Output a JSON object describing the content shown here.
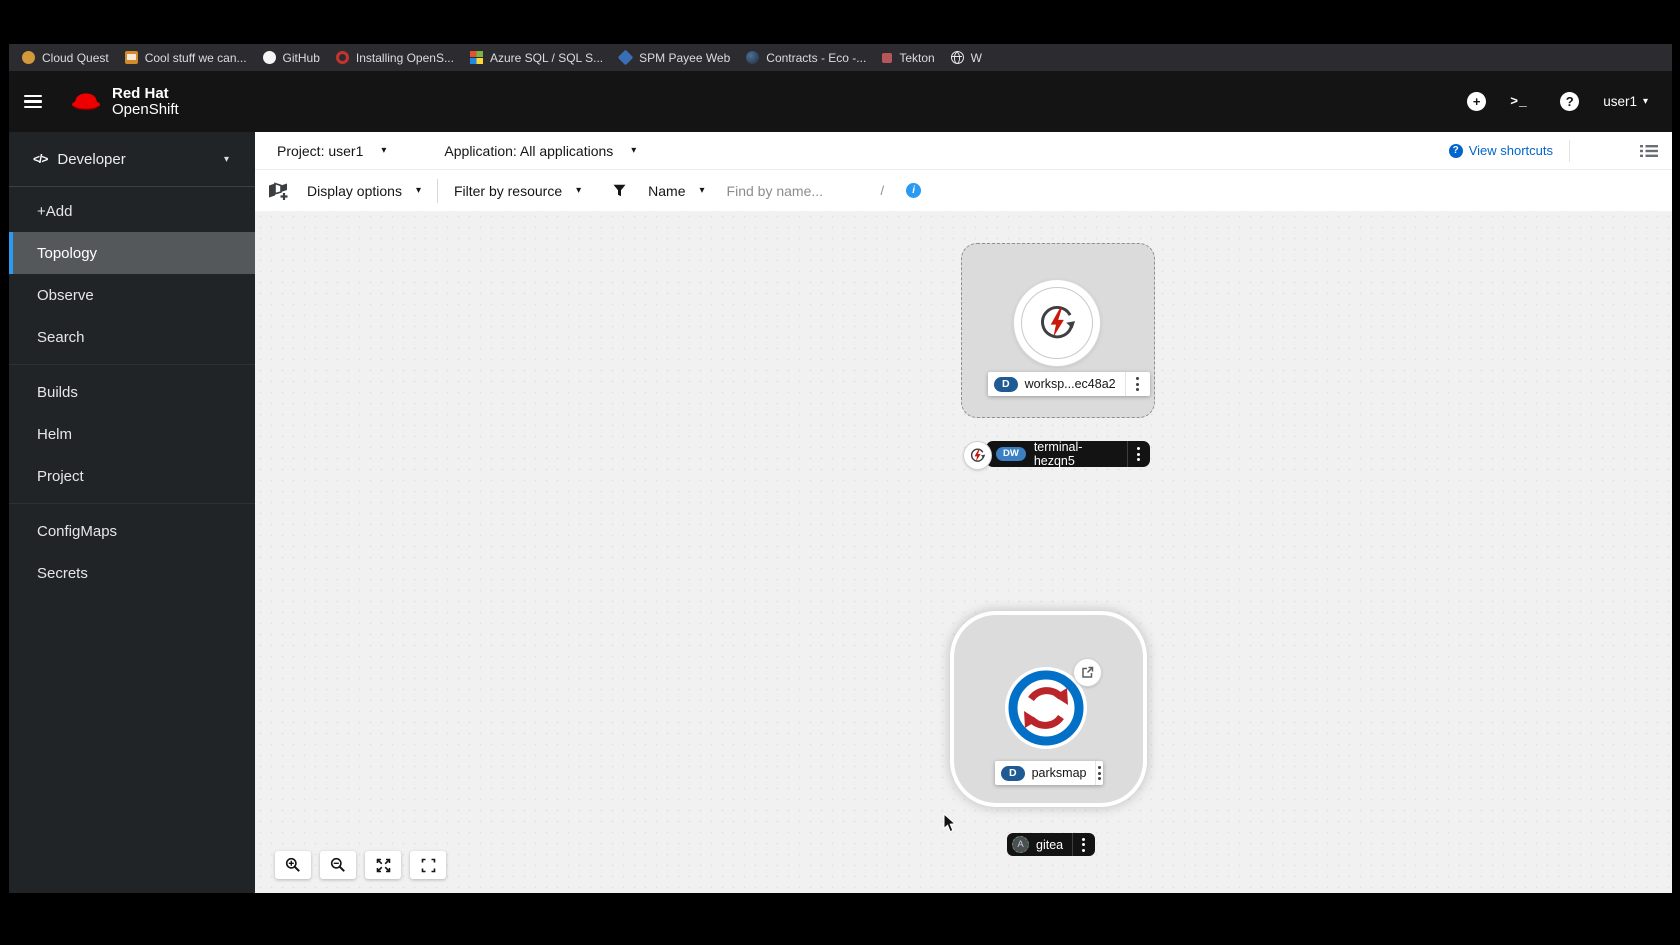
{
  "colors": {
    "brand_red": "#ee0000",
    "link_blue": "#0066cc",
    "info_blue": "#2b9af3",
    "nav_selected_border": "#2b9af3",
    "deployment_badge_blue": "#1f5a94",
    "devworkspace_badge_blue": "#3a80c2",
    "dark_label_bg": "#131313",
    "canvas_bg": "#f1f1f1"
  },
  "bookmarks_bar": {
    "items": [
      {
        "label": "Cloud Quest",
        "icon": "cloud-quest"
      },
      {
        "label": "Cool stuff we can...",
        "icon": "cool-stuff"
      },
      {
        "label": "GitHub",
        "icon": "github"
      },
      {
        "label": "Installing OpenS...",
        "icon": "openshift-docs"
      },
      {
        "label": "Azure SQL / SQL S...",
        "icon": "azure"
      },
      {
        "label": "SPM Payee Web",
        "icon": "spm"
      },
      {
        "label": "Contracts - Eco -...",
        "icon": "contracts"
      },
      {
        "label": "Tekton",
        "icon": "tekton"
      },
      {
        "label": "W",
        "icon": "globe"
      }
    ]
  },
  "masthead": {
    "brand_line1": "Red Hat",
    "brand_line2": "OpenShift",
    "plus_glyph": "+",
    "terminal_glyph": ">_",
    "help_glyph": "?",
    "user": "user1"
  },
  "sidebar": {
    "perspective": {
      "icon_glyph": "</>",
      "label": "Developer"
    },
    "groups": [
      [
        "+Add",
        "Topology",
        "Observe",
        "Search"
      ],
      [
        "Builds",
        "Helm",
        "Project"
      ],
      [
        "ConfigMaps",
        "Secrets"
      ]
    ],
    "active_item": "Topology"
  },
  "context_bar": {
    "project": "Project: user1",
    "application": "Application: All applications",
    "shortcuts_badge": "?",
    "view_shortcuts": "View shortcuts"
  },
  "filter_bar": {
    "display_options": "Display options",
    "filter_by_resource": "Filter by resource",
    "name_filter": "Name",
    "find_placeholder": "Find by name...",
    "slash_hint": "/",
    "info_glyph": "i"
  },
  "topology": {
    "workspace_node": {
      "badge": "D",
      "label": "worksp...ec48a2"
    },
    "terminal_node": {
      "badge": "DW",
      "label": "terminal-hezqn5"
    },
    "parksmap_node": {
      "badge": "D",
      "label": "parksmap"
    },
    "gitea_node": {
      "badge": "A",
      "label": "gitea"
    }
  }
}
